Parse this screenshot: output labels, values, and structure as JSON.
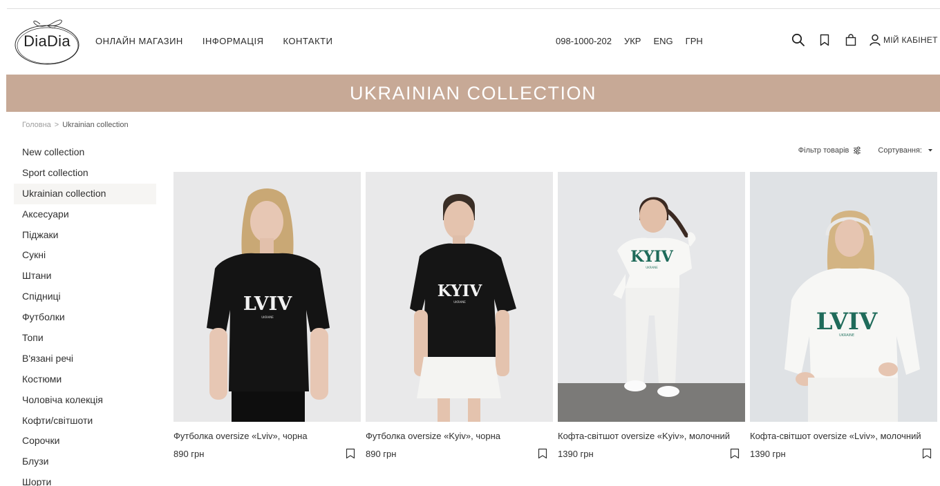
{
  "brand": {
    "logo_text": "DiaDia"
  },
  "nav": {
    "items": [
      "ОНЛАЙН МАГАЗИН",
      "ІНФОРМАЦІЯ",
      "КОНТАКТИ"
    ]
  },
  "contacts": {
    "phone": "098-1000-202",
    "lang_ukr": "УКР",
    "lang_eng": "ENG",
    "currency": "ГРН"
  },
  "account": {
    "label": "МІЙ КАБІНЕТ"
  },
  "icons": {
    "search": "search-icon",
    "wishlist": "bookmark-icon",
    "cart": "shopping-bag-icon",
    "user": "user-icon",
    "filter": "filter-icon",
    "sort": "caret-down-icon"
  },
  "banner": {
    "title": "UKRAINIAN COLLECTION",
    "color": "#c7a996"
  },
  "breadcrumb": {
    "home": "Головна",
    "separator": ">",
    "current": "Ukrainian collection"
  },
  "sidebar": {
    "active_index": 2,
    "items": [
      "New collection",
      "Sport collection",
      "Ukrainian collection",
      "Аксесуари",
      "Піджаки",
      "Сукні",
      "Штани",
      "Спідниці",
      "Футболки",
      "Топи",
      "В'язані речі",
      "Костюми",
      "Чоловіча колекція",
      "Кофти/світшоти",
      "Сорочки",
      "Блузи",
      "Шорти"
    ]
  },
  "toolbar": {
    "filter_label": "Фільтр товарів",
    "sort_label": "Сортування:"
  },
  "products": [
    {
      "name": "Футболка oversize «Lviv», чорна",
      "price": "890 грн",
      "print": "LVIV",
      "print_sub": "UKRAINE"
    },
    {
      "name": "Футболка oversize «Kyiv», чорна",
      "price": "890 грн",
      "print": "KYIV",
      "print_sub": "UKRAINE"
    },
    {
      "name": "Кофта-світшот oversize «Kyiv», молочний",
      "price": "1390 грн",
      "print": "KYIV",
      "print_sub": "UKRAINE"
    },
    {
      "name": "Кофта-світшот oversize «Lviv», молочний",
      "price": "1390 грн",
      "print": "LVIV",
      "print_sub": "UKRAINE"
    }
  ]
}
